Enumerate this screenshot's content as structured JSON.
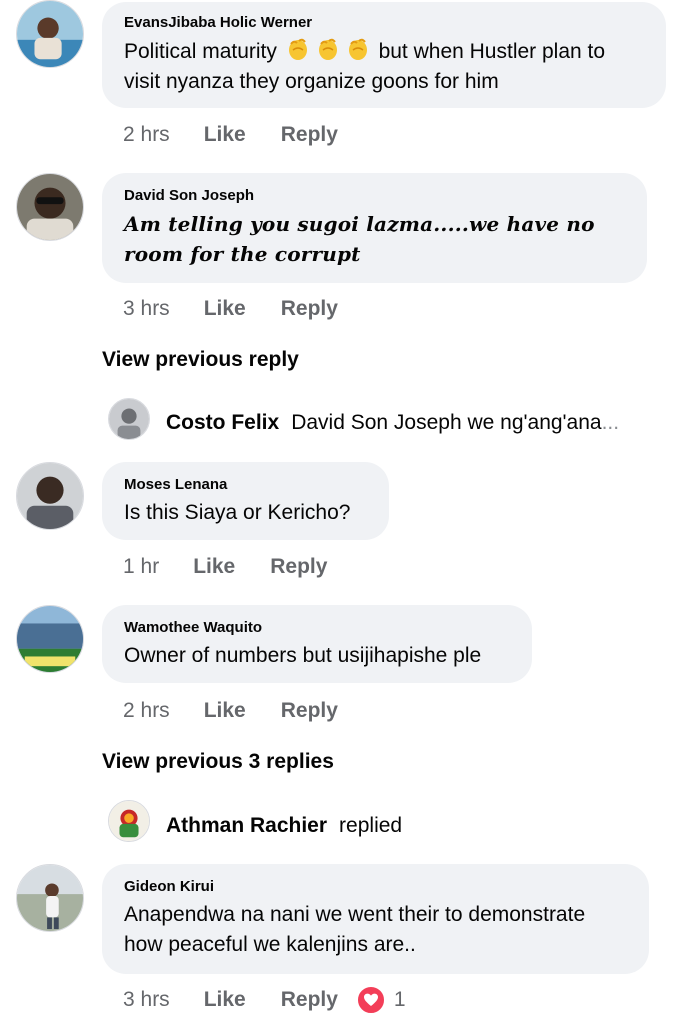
{
  "comments": [
    {
      "author": "EvansJibaba Holic Werner",
      "text_before": "Political maturity",
      "emojis": [
        "clapping-hands",
        "clapping-hands",
        "clapping-hands"
      ],
      "text_after": "but when Hustler plan to visit nyanza they organize goons for him",
      "time": "2 hrs",
      "like": "Like",
      "reply": "Reply"
    },
    {
      "author": "David Son Joseph",
      "text": "Am telling you sugoi lazma.....we have no room for the corrupt",
      "time": "3 hrs",
      "like": "Like",
      "reply": "Reply",
      "view_previous": "View previous reply",
      "reply_preview": {
        "name": "Costo Felix",
        "text": "David Son Joseph we ng'ang'ana",
        "ellipsis": "..."
      }
    },
    {
      "author": "Moses Lenana",
      "text": "Is this Siaya or Kericho?",
      "time": "1 hr",
      "like": "Like",
      "reply": "Reply"
    },
    {
      "author": "Wamothee Waquito",
      "text": "Owner of numbers but usijihapishe ple",
      "time": "2 hrs",
      "like": "Like",
      "reply": "Reply",
      "view_previous": "View previous 3 replies",
      "reply_preview": {
        "name": "Athman Rachier",
        "text": "replied"
      }
    },
    {
      "author": "Gideon Kirui",
      "text": "Anapendwa na nani we went their to demonstrate how peaceful we kalenjins are..",
      "time": "3 hrs",
      "like": "Like",
      "reply": "Reply",
      "reaction": {
        "icon": "heart-icon",
        "count": "1"
      }
    }
  ],
  "colors": {
    "bubble": "#f0f2f5",
    "meta": "#65676b",
    "heart": "#f33e58"
  }
}
